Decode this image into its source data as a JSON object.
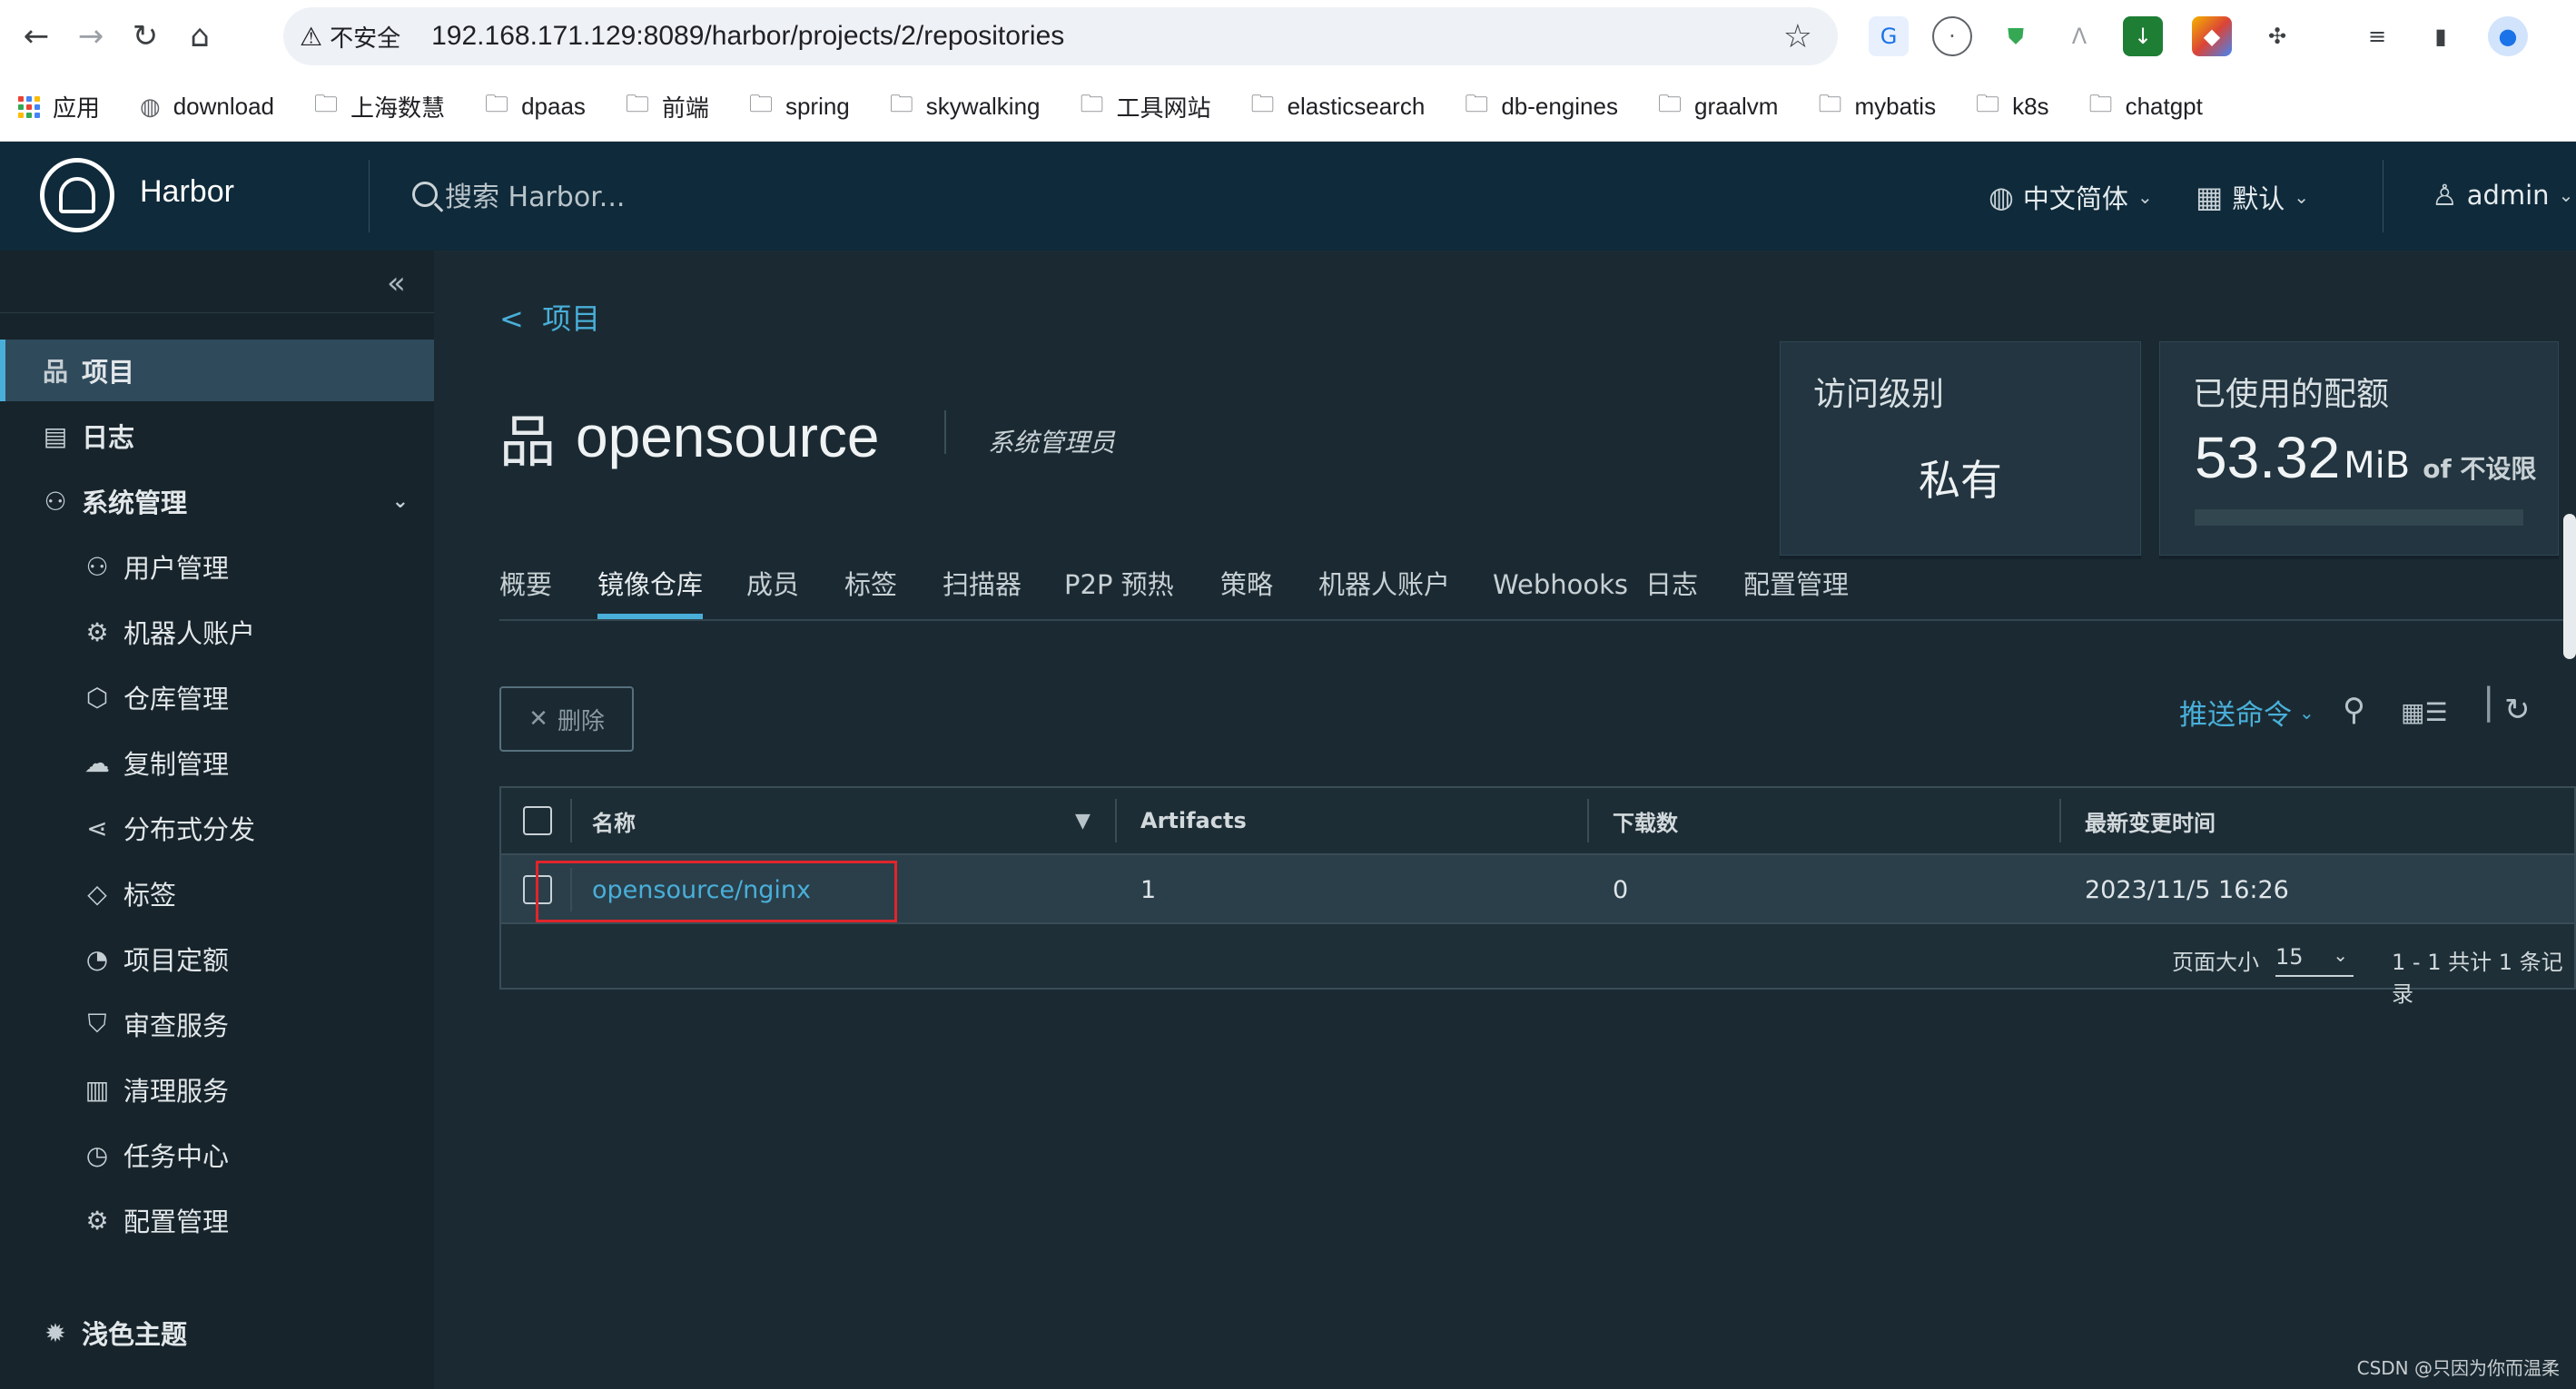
{
  "browser": {
    "insecure_label": "不安全",
    "url": "192.168.171.129:8089/harbor/projects/2/repositories",
    "bookmarks": [
      "应用",
      "download",
      "上海数慧",
      "dpaas",
      "前端",
      "spring",
      "skywalking",
      "工具网站",
      "elasticsearch",
      "db-engines",
      "graalvm",
      "mybatis",
      "k8s",
      "chatgpt"
    ]
  },
  "header": {
    "brand": "Harbor",
    "search_placeholder": "搜索 Harbor...",
    "language": "中文简体",
    "date_format": "默认",
    "user": "admin"
  },
  "sidebar": {
    "projects": "项目",
    "logs": "日志",
    "admin": "系统管理",
    "sub_items": [
      "用户管理",
      "机器人账户",
      "仓库管理",
      "复制管理",
      "分布式分发",
      "标签",
      "项目定额",
      "审查服务",
      "清理服务",
      "任务中心",
      "配置管理"
    ],
    "theme": "浅色主题"
  },
  "project": {
    "back_label": "项目",
    "name": "opensource",
    "role": "系统管理员",
    "access_title": "访问级别",
    "access_value": "私有",
    "quota_title": "已使用的配额",
    "quota_value": "53.32",
    "quota_unit": "MiB",
    "quota_of": "of 不设限"
  },
  "tabs": [
    "概要",
    "镜像仓库",
    "成员",
    "标签",
    "扫描器",
    "P2P 预热",
    "策略",
    "机器人账户",
    "Webhooks",
    "日志",
    "配置管理"
  ],
  "toolbar": {
    "delete_label": "删除",
    "push_command": "推送命令"
  },
  "table": {
    "columns": [
      "名称",
      "Artifacts",
      "下载数",
      "最新变更时间"
    ],
    "rows": [
      {
        "name": "opensource/nginx",
        "artifacts": "1",
        "pulls": "0",
        "updated": "2023/11/5 16:26"
      }
    ],
    "page_size_label": "页面大小",
    "page_size": "15",
    "summary": "1 - 1 共计 1 条记录"
  },
  "watermark": "CSDN @只因为你而温柔"
}
